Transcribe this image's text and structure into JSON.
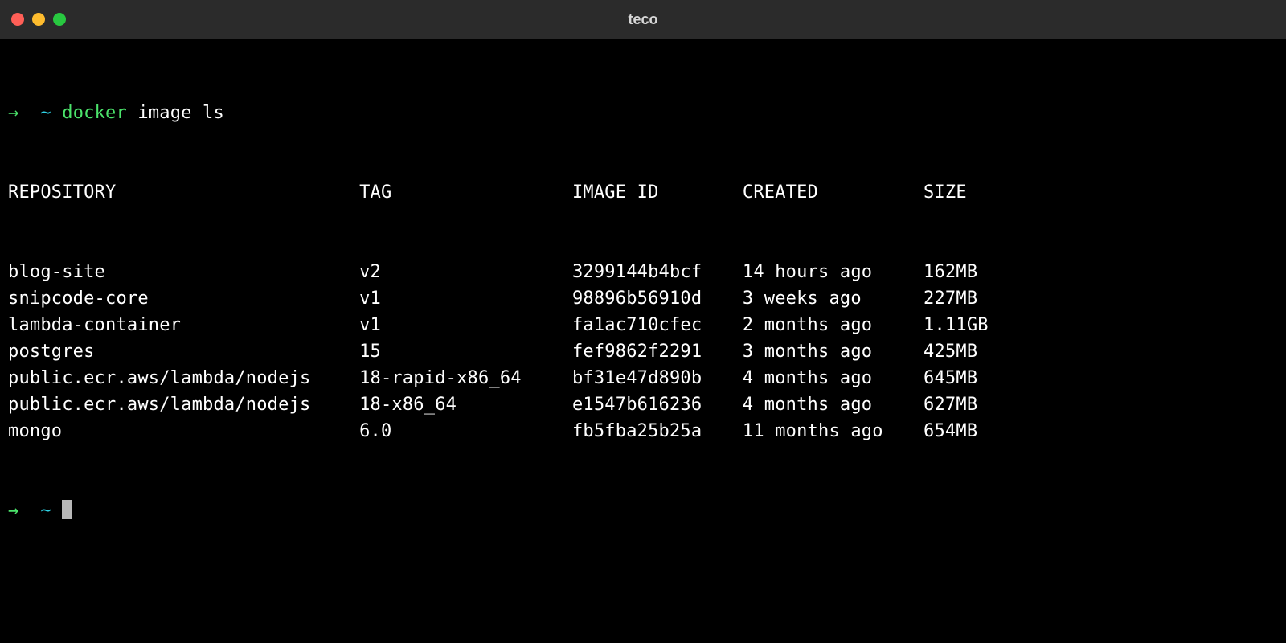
{
  "window": {
    "title": "teco"
  },
  "prompt": {
    "arrow": "→",
    "tilde": "~",
    "command_part1": "docker",
    "command_part2": "image ls"
  },
  "table": {
    "headers": {
      "repository": "REPOSITORY",
      "tag": "TAG",
      "image_id": "IMAGE ID",
      "created": "CREATED",
      "size": "SIZE"
    },
    "rows": [
      {
        "repository": "blog-site",
        "tag": "v2",
        "image_id": "3299144b4bcf",
        "created": "14 hours ago",
        "size": "162MB"
      },
      {
        "repository": "snipcode-core",
        "tag": "v1",
        "image_id": "98896b56910d",
        "created": "3 weeks ago",
        "size": "227MB"
      },
      {
        "repository": "lambda-container",
        "tag": "v1",
        "image_id": "fa1ac710cfec",
        "created": "2 months ago",
        "size": "1.11GB"
      },
      {
        "repository": "postgres",
        "tag": "15",
        "image_id": "fef9862f2291",
        "created": "3 months ago",
        "size": "425MB"
      },
      {
        "repository": "public.ecr.aws/lambda/nodejs",
        "tag": "18-rapid-x86_64",
        "image_id": "bf31e47d890b",
        "created": "4 months ago",
        "size": "645MB"
      },
      {
        "repository": "public.ecr.aws/lambda/nodejs",
        "tag": "18-x86_64",
        "image_id": "e1547b616236",
        "created": "4 months ago",
        "size": "627MB"
      },
      {
        "repository": "mongo",
        "tag": "6.0",
        "image_id": "fb5fba25b25a",
        "created": "11 months ago",
        "size": "654MB"
      }
    ]
  },
  "prompt2": {
    "arrow": "→",
    "tilde": "~"
  }
}
